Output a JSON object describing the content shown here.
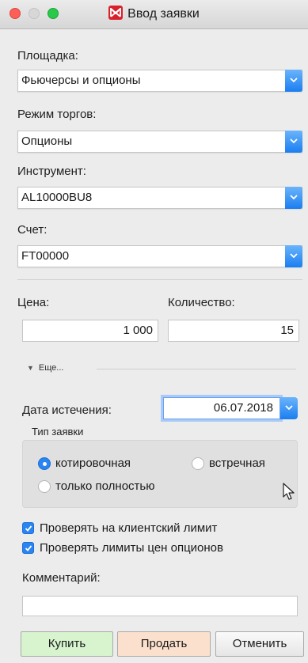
{
  "window": {
    "title": "Ввод заявки",
    "colors": {
      "accent": "#2a84f2",
      "buy": "#d7f4cf",
      "sell": "#fbe1cd",
      "brand": "#d8222b"
    }
  },
  "form": {
    "venue": {
      "label": "Площадка:",
      "value": "Фьючерсы и опционы"
    },
    "mode": {
      "label": "Режим торгов:",
      "value": "Опционы"
    },
    "instrument": {
      "label": "Инструмент:",
      "value": "AL10000BU8"
    },
    "account": {
      "label": "Счет:",
      "value": "FT00000"
    },
    "price": {
      "label": "Цена:",
      "value": "1 000"
    },
    "quantity": {
      "label": "Количество:",
      "value": "15"
    },
    "more": {
      "label": "Еще..."
    },
    "expiry": {
      "label": "Дата истечения:",
      "value": "06.07.2018"
    },
    "order_type": {
      "label": "Тип заявки",
      "options": [
        {
          "label": "котировочная",
          "selected": true
        },
        {
          "label": "встречная",
          "selected": false
        },
        {
          "label": "только полностью",
          "selected": false
        }
      ]
    },
    "checks": [
      {
        "label": "Проверять на клиентский лимит",
        "checked": true
      },
      {
        "label": "Проверять лимиты цен опционов",
        "checked": true
      }
    ],
    "comment": {
      "label": "Комментарий:",
      "value": ""
    }
  },
  "buttons": {
    "buy": "Купить",
    "sell": "Продать",
    "cancel": "Отменить"
  }
}
